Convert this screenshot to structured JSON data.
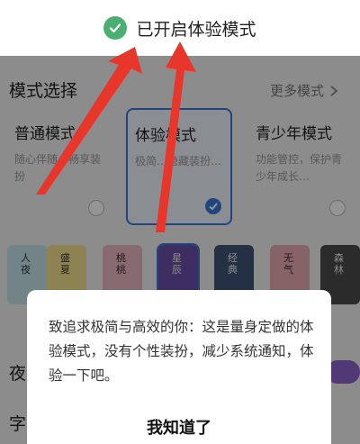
{
  "toast": {
    "message": "已开启体验模式",
    "icon": "check-circle-icon",
    "icon_color": "#4caf72"
  },
  "section": {
    "title": "模式选择",
    "more_label": "更多模式",
    "more_icon": "chevron-right-icon"
  },
  "modes": [
    {
      "title": "普通模式",
      "desc": "随心伴随…畅享装扮",
      "selected": false
    },
    {
      "title": "体验模式",
      "desc": "极简…隐藏装扮…",
      "selected": true
    },
    {
      "title": "青少年模式",
      "desc": "功能管控，保护青少年成长…",
      "selected": false
    }
  ],
  "themes": [
    {
      "label": "人夜",
      "color": "#c7e3ea"
    },
    {
      "label": "盛夏",
      "color": "#f3e28d"
    },
    {
      "label": "桃桃",
      "color": "#e8b8c2"
    },
    {
      "label": "星辰",
      "color": "#6a4ea8"
    },
    {
      "label": "经典",
      "color": "#3e5575"
    },
    {
      "label": "无气",
      "color": "#e8a9b2"
    },
    {
      "label": "森林",
      "color": "#4a4a4a"
    }
  ],
  "settings": {
    "night_label": "夜",
    "second_label": "字"
  },
  "dialog": {
    "body": "致追求极简与高效的你：这是量身定做的体验模式，没有个性装扮，减少系统通知，体验一下吧。",
    "button_label": "我知道了"
  },
  "colors": {
    "accent": "#3b78d8",
    "arrow": "#e8362b",
    "toggle": "#8a62c8"
  }
}
